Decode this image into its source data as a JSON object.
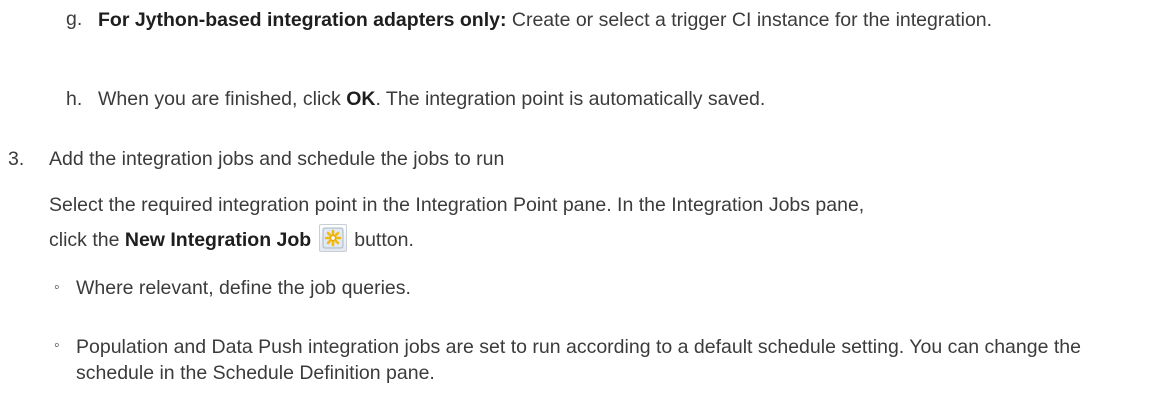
{
  "steps": {
    "g": {
      "marker": "g.",
      "bold": "For Jython-based integration adapters only:",
      "text": " Create or select a trigger CI instance for the integration."
    },
    "h": {
      "marker": "h.",
      "text_before": "When you are finished, click ",
      "bold": "OK",
      "text_after": ". The integration point is automatically saved."
    },
    "step3": {
      "marker": "3.",
      "title": "Add the integration jobs and schedule the jobs to run",
      "para1": "Select the required integration point in the Integration Point pane. In the Integration Jobs pane,",
      "para2_before": "click the ",
      "para2_bold": "New Integration Job",
      "para2_after": "button.",
      "icon": "new-integration-job-icon",
      "bullets": [
        {
          "marker": "◦",
          "text": "Where relevant, define the job queries."
        },
        {
          "marker": "◦",
          "text": "Population and Data Push integration jobs are set to run according to a default schedule setting. You can change the schedule in the Schedule Definition pane."
        }
      ]
    }
  },
  "colors": {
    "text": "#3b3b3b",
    "icon_star": "#f2b90f"
  }
}
